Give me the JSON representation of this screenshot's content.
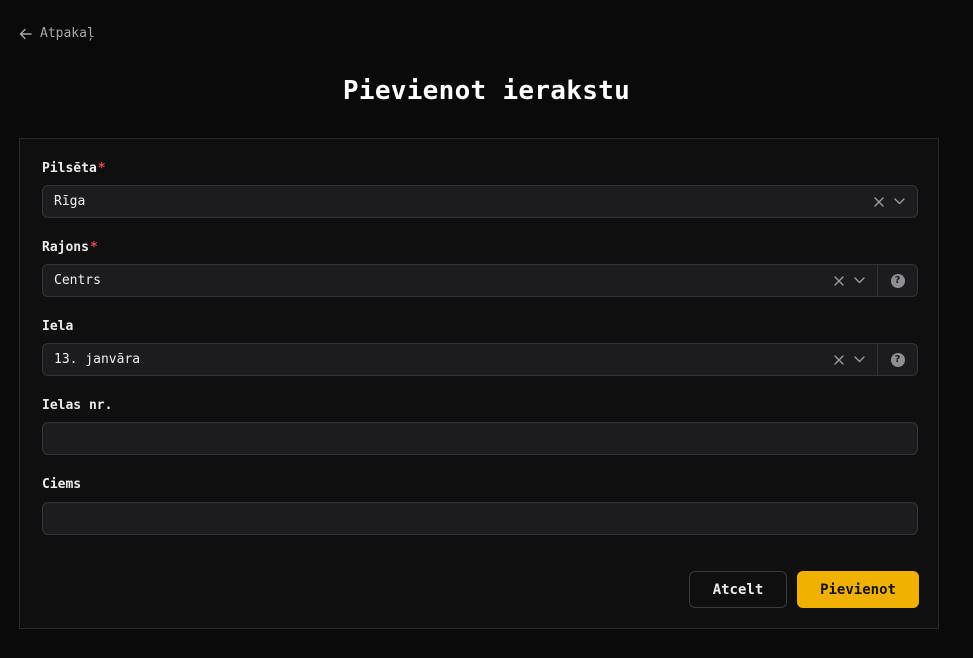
{
  "nav": {
    "back_label": "Atpakaļ"
  },
  "page": {
    "title": "Pievienot ierakstu"
  },
  "form": {
    "city": {
      "label": "Pilsēta",
      "required_mark": "*",
      "value": "Rīga"
    },
    "district": {
      "label": "Rajons",
      "required_mark": "*",
      "value": "Centrs",
      "help_glyph": "?"
    },
    "street": {
      "label": "Iela",
      "value": "13. janvāra",
      "help_glyph": "?"
    },
    "street_number": {
      "label": "Ielas nr.",
      "value": ""
    },
    "village": {
      "label": "Ciems",
      "value": ""
    }
  },
  "actions": {
    "cancel_label": "Atcelt",
    "submit_label": "Pievienot"
  },
  "icons": {
    "back": "arrow-left-icon",
    "clear": "close-icon",
    "dropdown": "chevron-down-icon",
    "help": "question-circle-icon"
  },
  "colors": {
    "background": "#0a0a0b",
    "card": "#0f0f10",
    "input": "#1c1c1f",
    "accent": "#f0b000",
    "required": "#e5484d"
  }
}
